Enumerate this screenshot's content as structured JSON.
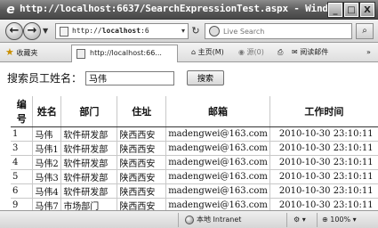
{
  "window": {
    "title": "http://localhost:6637/SearchExpressionTest.aspx - Windows...",
    "buttons": {
      "minimize": "_",
      "maximize": "□",
      "close": "X"
    }
  },
  "address_bar": {
    "url_prefix": "http://",
    "url_host": "localhost",
    "url_rest": ":6",
    "search_placeholder": "Live Search"
  },
  "favorites_bar": {
    "favorites_label": "收藏夹",
    "tab_title": "http://localhost:66...",
    "home_label": "主页(M)",
    "feeds_label": "源(0)",
    "read_mail_label": "阅读邮件",
    "more": "»"
  },
  "search_form": {
    "label": "搜索员工姓名：",
    "value": "马伟",
    "button_label": "搜索"
  },
  "table": {
    "columns": [
      "编号",
      "姓名",
      "部门",
      "住址",
      "邮箱",
      "工作时间"
    ],
    "rows": [
      [
        "1",
        "马伟",
        "软件研发部",
        "陕西西安",
        "madengwei@163.com",
        "2010-10-30 23:10:11"
      ],
      [
        "3",
        "马伟1",
        "软件研发部",
        "陕西西安",
        "madengwei@163.com",
        "2010-10-30 23:10:11"
      ],
      [
        "4",
        "马伟2",
        "软件研发部",
        "陕西西安",
        "madengwei@163.com",
        "2010-10-30 23:10:11"
      ],
      [
        "5",
        "马伟3",
        "软件研发部",
        "陕西西安",
        "madengwei@163.com",
        "2010-10-30 23:10:11"
      ],
      [
        "6",
        "马伟4",
        "软件研发部",
        "陕西西安",
        "madengwei@163.com",
        "2010-10-30 23:10:11"
      ],
      [
        "9",
        "马伟7",
        "市场部门",
        "陕西西安",
        "madengwei@163.com",
        "2010-10-30 23:10:11"
      ]
    ]
  },
  "status_bar": {
    "zone": "本地 Intranet",
    "zoom": "100%"
  }
}
